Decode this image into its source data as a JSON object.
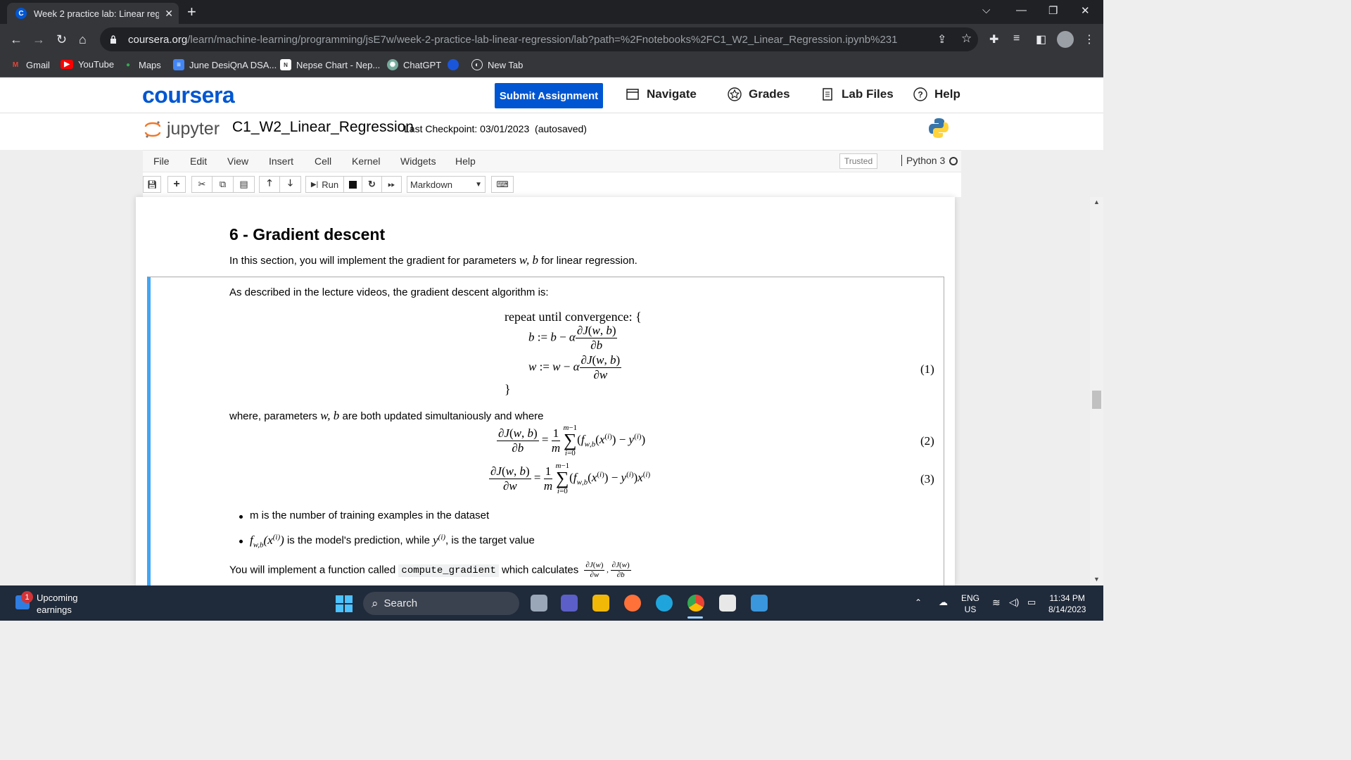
{
  "browser": {
    "tab_title": "Week 2 practice lab: Linear regre",
    "url_domain": "coursera.org",
    "url_path": "/learn/machine-learning/programming/jsE7w/week-2-practice-lab-linear-regression/lab?path=%2Fnotebooks%2FC1_W2_Linear_Regression.ipynb%231",
    "bookmarks": [
      "Gmail",
      "YouTube",
      "Maps",
      "June DesiQnA DSA...",
      "Nepse Chart - Nep...",
      "ChatGPT",
      "",
      "New Tab"
    ]
  },
  "coursera": {
    "logo": "coursera",
    "submit_label": "Submit Assignment",
    "nav": [
      "Navigate",
      "Grades",
      "Lab Files",
      "Help"
    ],
    "brand_color": "#0056d2"
  },
  "jupyter": {
    "logo_text": "jupyter",
    "notebook_name": "C1_W2_Linear_Regression",
    "checkpoint": "Last Checkpoint: 03/01/2023",
    "autosaved": "(autosaved)",
    "menus": [
      "File",
      "Edit",
      "View",
      "Insert",
      "Cell",
      "Kernel",
      "Widgets",
      "Help"
    ],
    "trusted": "Trusted",
    "kernel": "Python 3",
    "run_label": "Run",
    "cell_type": "Markdown"
  },
  "notebook": {
    "heading": "6 - Gradient descent",
    "intro_pre": "In this section, you will implement the gradient for parameters",
    "intro_math": "w, b",
    "intro_post": "for linear regression.",
    "described": "As described in the lecture videos, the gradient descent algorithm is:",
    "repeat": "repeat until convergence: {",
    "close_brace": "}",
    "eq1_label": "(1)",
    "where_pre": "where, parameters",
    "where_math": "w, b",
    "where_post": "are both updated simultaniously and where",
    "eq2_label": "(2)",
    "eq3_label": "(3)",
    "bullet1": "m is the number of training examples in the dataset",
    "bullet2_post": "is the model's prediction, while",
    "bullet2_end": ", is the target value",
    "implement_pre": "You will implement a function called",
    "implement_code": "compute_gradient",
    "implement_post": "which calculates"
  },
  "taskbar": {
    "weather_badge": "1",
    "weather_line1": "Upcoming",
    "weather_line2": "earnings",
    "search": "Search",
    "lang1": "ENG",
    "lang2": "US",
    "time": "11:34 PM",
    "date": "8/14/2023"
  }
}
